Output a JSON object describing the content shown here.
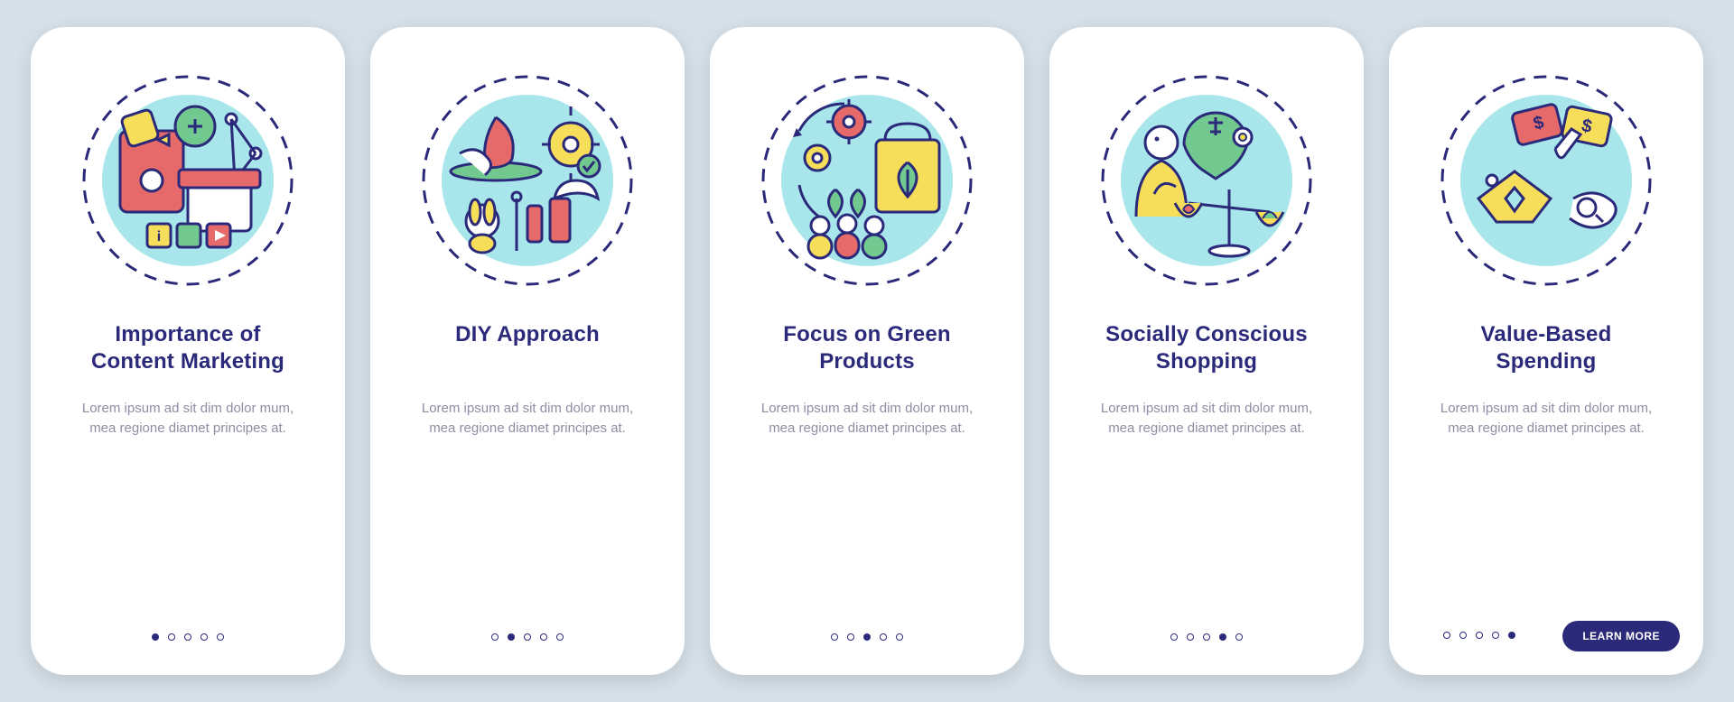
{
  "colors": {
    "background": "#d6e0e8",
    "card": "#ffffff",
    "primary": "#2b2a7a",
    "text_muted": "#8d8da6",
    "accent_cyan": "#a8e6eb",
    "accent_red": "#e66a6a",
    "accent_yellow": "#f7de5a",
    "accent_green": "#72c98f"
  },
  "screens": [
    {
      "title": "Importance of\nContent Marketing",
      "body": "Lorem ipsum ad sit dim dolor mum, mea regione diamet principes at.",
      "active_dot": 0
    },
    {
      "title": "DIY Approach",
      "body": "Lorem ipsum ad sit dim dolor mum, mea regione diamet principes at.",
      "active_dot": 1
    },
    {
      "title": "Focus on Green\nProducts",
      "body": "Lorem ipsum ad sit dim dolor mum, mea regione diamet principes at.",
      "active_dot": 2
    },
    {
      "title": "Socially Conscious\nShopping",
      "body": "Lorem ipsum ad sit dim dolor mum, mea regione diamet principes at.",
      "active_dot": 3
    },
    {
      "title": "Value-Based\nSpending",
      "body": "Lorem ipsum ad sit dim dolor mum, mea regione diamet principes at.",
      "active_dot": 4,
      "cta": "LEARN MORE"
    }
  ],
  "total_dots": 5
}
